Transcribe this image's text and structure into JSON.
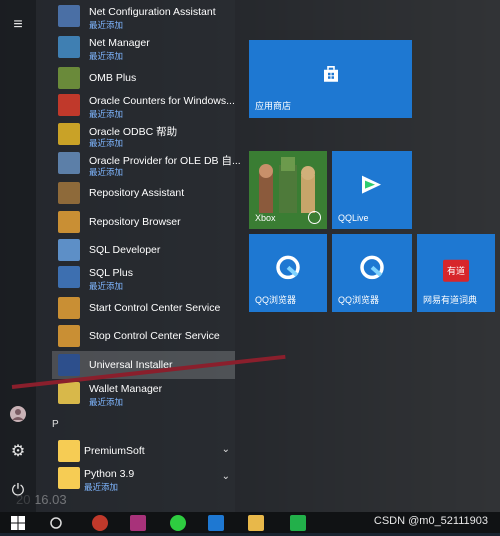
{
  "rail": {
    "hamburger_icon": "hamburger-icon",
    "avatar_icon": "avatar",
    "settings_icon": "gear-icon",
    "power_icon": "power-icon"
  },
  "apps": [
    {
      "name": "Net Configuration Assistant",
      "sub": "最近添加",
      "color": "#4a6fa5"
    },
    {
      "name": "Net Manager",
      "sub": "最近添加",
      "color": "#3f7fb2"
    },
    {
      "name": "OMB Plus",
      "sub": "",
      "color": "#6a8a3a"
    },
    {
      "name": "Oracle Counters for Windows...",
      "sub": "最近添加",
      "color": "#c0392b"
    },
    {
      "name": "Oracle ODBC 帮助",
      "sub": "最近添加",
      "color": "#c9a227"
    },
    {
      "name": "Oracle Provider for OLE DB 自...",
      "sub": "最近添加",
      "color": "#5c7fa8"
    },
    {
      "name": "Repository Assistant",
      "sub": "",
      "color": "#8e6a3a"
    },
    {
      "name": "Repository Browser",
      "sub": "",
      "color": "#c98f34"
    },
    {
      "name": "SQL Developer",
      "sub": "",
      "color": "#5d8fc7"
    },
    {
      "name": "SQL Plus",
      "sub": "最近添加",
      "color": "#3d6fb0"
    },
    {
      "name": "Start Control Center Service",
      "sub": "",
      "color": "#c98f34"
    },
    {
      "name": "Stop Control Center Service",
      "sub": "",
      "color": "#c98f34"
    },
    {
      "name": "Universal Installer",
      "sub": "",
      "color": "#2d4f8c"
    },
    {
      "name": "Wallet Manager",
      "sub": "最近添加",
      "color": "#d8b84a"
    }
  ],
  "section_letter": "P",
  "folders": [
    {
      "name": "PremiumSoft",
      "sub": ""
    },
    {
      "name": "Python 3.9",
      "sub": "最近添加"
    }
  ],
  "tiles": {
    "store": {
      "label": "应用商店",
      "icon": "store-icon"
    },
    "xbox": {
      "label": "Xbox",
      "icon": "xbox-icon"
    },
    "qqlive": {
      "label": "QQLive",
      "icon": "qqlive-icon"
    },
    "qqbrowser1": {
      "label": "QQ浏览器",
      "icon": "qqbrowser-icon"
    },
    "qqbrowser2": {
      "label": "QQ浏览器",
      "icon": "qqbrowser-icon"
    },
    "youdao": {
      "label": "网易有道词典",
      "icon_text": "有道"
    }
  },
  "taskbar": {
    "items": [
      "windows-start-icon",
      "search-icon",
      "app-icon",
      "jetbrains-icon",
      "wechat-icon",
      "wps-icon",
      "file-explorer-icon",
      "media-player-icon"
    ]
  },
  "watermark": "CSDN @m0_52111903",
  "colors": {
    "tile_blue": "#1e78d2",
    "annotation_line": "#8a1f2c",
    "sub_text": "#7fb6ff"
  }
}
